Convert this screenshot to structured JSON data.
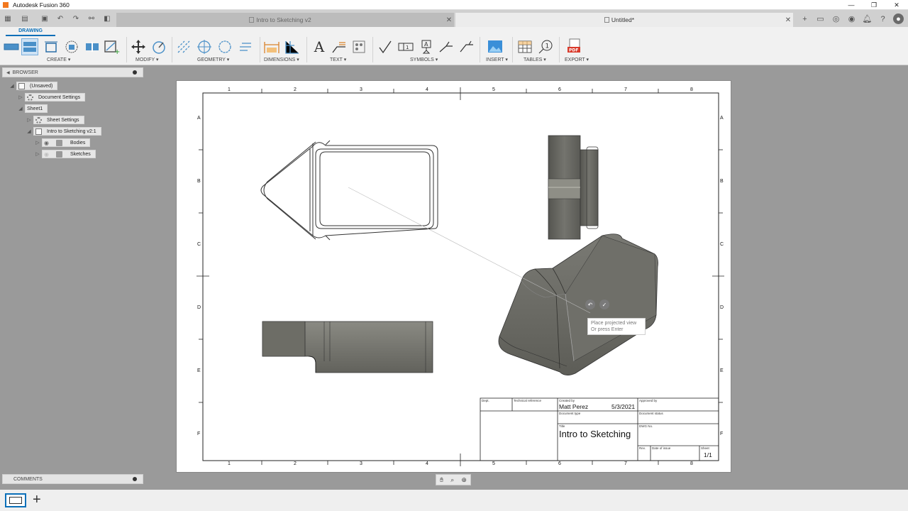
{
  "app": {
    "title": "Autodesk Fusion 360"
  },
  "tabs": {
    "inactive": {
      "label": "Intro to Sketching v2"
    },
    "active": {
      "label": "Untitled*"
    }
  },
  "toolbar": {
    "workspace": "DRAWING",
    "groups": {
      "create": "CREATE ▾",
      "modify": "MODIFY ▾",
      "geometry": "GEOMETRY ▾",
      "dimensions": "DIMENSIONS ▾",
      "text": "TEXT ▾",
      "symbols": "SYMBOLS ▾",
      "insert": "INSERT ▾",
      "tables": "TABLES ▾",
      "export": "EXPORT ▾"
    }
  },
  "browser": {
    "title": "BROWSER",
    "items": [
      {
        "label": "(Unsaved)"
      },
      {
        "label": "Document Settings"
      },
      {
        "label": "Sheet1"
      },
      {
        "label": "Sheet Settings"
      },
      {
        "label": "Intro to Sketching v2:1"
      },
      {
        "label": "Bodies"
      },
      {
        "label": "Sketches"
      }
    ]
  },
  "comments": {
    "title": "COMMENTS"
  },
  "sheet": {
    "border_cols": [
      "1",
      "2",
      "3",
      "4",
      "5",
      "6",
      "7",
      "8"
    ],
    "border_rows": [
      "A",
      "B",
      "C",
      "D",
      "E",
      "F"
    ],
    "title_block": {
      "dept_label": "Dept.",
      "tech_ref_label": "Technical reference",
      "created_by_label": "Created by",
      "created_by": "Matt Perez",
      "date": "5/3/2021",
      "approved_by_label": "Approved by",
      "doc_type_label": "Document type",
      "doc_status_label": "Document status",
      "title_label": "Title",
      "title": "Intro to Sketching",
      "dwg_no_label": "DWG No.",
      "rev_label": "Rev.",
      "date_issue_label": "Date of issue",
      "sheet_label": "Sheet",
      "sheet": "1/1"
    }
  },
  "tooltip": {
    "line1": "Place projected view",
    "line2": "Or press Enter"
  },
  "icons": [
    "grid-icon",
    "file-icon",
    "save-icon",
    "undo-icon",
    "redo-icon",
    "link-icon",
    "share-icon",
    "hand-icon",
    "zoom-icon",
    "zoom-window-icon"
  ]
}
